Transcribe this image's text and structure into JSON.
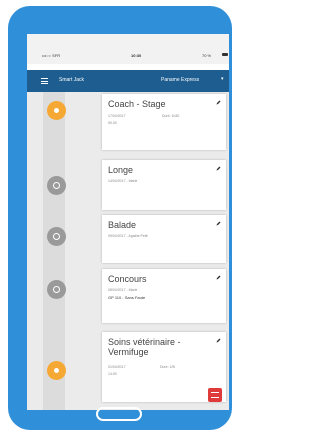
{
  "status_bar": {
    "carrier": "•••○○ SFR",
    "time": "10:30",
    "battery": "70 %"
  },
  "app_bar": {
    "title": "Smart Jack",
    "horse_name": "Paname Express",
    "chevron_icon": "chevron-down-icon",
    "menu_icon": "menu-icon"
  },
  "events": [
    {
      "title": "Coach - Stage",
      "date": "17/04/2017",
      "duration": "Duré: 1h30",
      "extra": "90,00",
      "marker_color": "#f5a833",
      "marker_icon": "person-icon"
    },
    {
      "title": "Longe",
      "date": "14/04/2017 - Marie",
      "marker_color": "#9a9a9a",
      "marker_icon": "activity-icon"
    },
    {
      "title": "Balade",
      "date": "09/04/2017 - Agathe Petit",
      "marker_color": "#9a9a9a",
      "marker_icon": "activity-icon"
    },
    {
      "title": "Concours",
      "date": "08/04/2017 - Marie",
      "detail": "GP 110 - Sans Faute",
      "marker_color": "#9a9a9a",
      "marker_icon": "activity-icon"
    },
    {
      "title": "Soins vétérinaire - Vermifuge",
      "date": "01/04/2017",
      "duration": "Duré: 1/B",
      "extra": "14:00",
      "marker_color": "#f5a833",
      "marker_icon": "person-icon"
    }
  ],
  "fab": {
    "icon": "add-event-icon",
    "color": "#e03b3b"
  },
  "colors": {
    "device": "#2f8fd9",
    "app_bar": "#1d5d8f",
    "accent": "#f5a833"
  }
}
